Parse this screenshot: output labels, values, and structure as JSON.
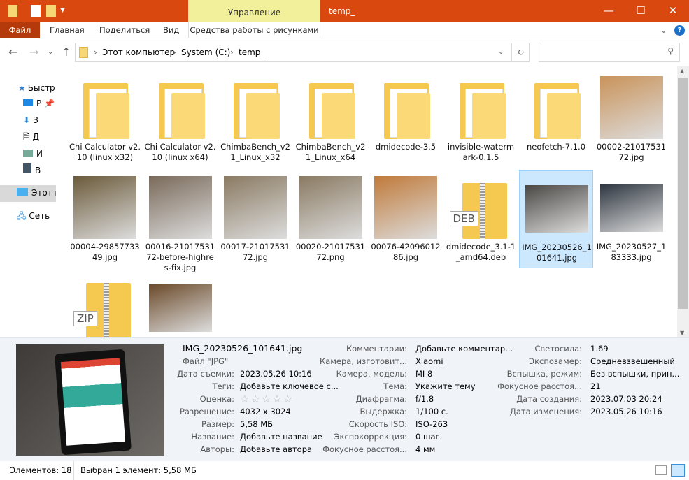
{
  "window": {
    "title": "temp_",
    "context_tab": "Управление",
    "minimize": "—",
    "maximize": "☐",
    "close": "✕"
  },
  "ribbon": {
    "tabs": [
      "Файл",
      "Главная",
      "Поделиться",
      "Вид",
      "Средства работы с рисунками"
    ],
    "expand": "⌄",
    "help": "?"
  },
  "address": {
    "crumbs": [
      "Этот компьютер",
      "System (C:)",
      "temp_"
    ],
    "search_placeholder": ""
  },
  "nav_pane": {
    "items": [
      "Быстр",
      "Р",
      "З",
      "Д",
      "И",
      "В",
      "Этот к",
      "Сеть"
    ]
  },
  "files": [
    {
      "name": "Chi Calculator v2.10 (linux x32)",
      "type": "folder"
    },
    {
      "name": "Chi Calculator v2.10 (linux x64)",
      "type": "folder"
    },
    {
      "name": "ChimbaBench_v21_Linux_x32",
      "type": "folder"
    },
    {
      "name": "ChimbaBench_v21_Linux_x64",
      "type": "folder"
    },
    {
      "name": "dmidecode-3.5",
      "type": "folder"
    },
    {
      "name": "invisible-watermark-0.1.5",
      "type": "folder"
    },
    {
      "name": "neofetch-7.1.0",
      "type": "folder"
    },
    {
      "name": "00002-2101753172.jpg",
      "type": "image",
      "color": "#c9935a"
    },
    {
      "name": "00004-2985773349.jpg",
      "type": "image",
      "color": "#6b5a3a"
    },
    {
      "name": "00016-2101753172-before-highres-fix.jpg",
      "type": "image",
      "color": "#7a6a5a"
    },
    {
      "name": "00017-2101753172.jpg",
      "type": "image",
      "color": "#8a7a62"
    },
    {
      "name": "00020-2101753172.png",
      "type": "image",
      "color": "#8a7a62"
    },
    {
      "name": "00076-4209601286.jpg",
      "type": "image",
      "color": "#c07a3a"
    },
    {
      "name": "dmidecode_3.1-1_amd64.deb",
      "type": "archive",
      "tag": "DEB"
    },
    {
      "name": "IMG_20230526_101641.jpg",
      "type": "image",
      "color": "#4a4744",
      "selected": true
    },
    {
      "name": "IMG_20230527_183333.jpg",
      "type": "image",
      "color": "#2e3640"
    },
    {
      "name": "",
      "type": "archive",
      "tag": "ZIP"
    },
    {
      "name": "",
      "type": "image",
      "color": "#6b4a2a"
    }
  ],
  "details": {
    "filename": "IMG_20230526_101641.jpg",
    "filetype": "Файл \"JPG\"",
    "col1": [
      [
        "Дата съемки:",
        "2023.05.26 10:16"
      ],
      [
        "Теги:",
        "Добавьте ключевое с..."
      ],
      [
        "Оценка:",
        "☆☆☆☆☆"
      ],
      [
        "Разрешение:",
        "4032 x 3024"
      ],
      [
        "Размер:",
        "5,58 МБ"
      ],
      [
        "Название:",
        "Добавьте название"
      ],
      [
        "Авторы:",
        "Добавьте автора"
      ]
    ],
    "col2": [
      [
        "Комментарии:",
        "Добавьте комментар..."
      ],
      [
        "Камера, изготовит...",
        "Xiaomi"
      ],
      [
        "Камера, модель:",
        "MI 8"
      ],
      [
        "Тема:",
        "Укажите тему"
      ],
      [
        "Диафрагма:",
        "f/1.8"
      ],
      [
        "Выдержка:",
        "1/100 с."
      ],
      [
        "Скорость ISO:",
        "ISO-263"
      ],
      [
        "Экспокоррекция:",
        "0 шаг."
      ],
      [
        "Фокусное расстоя...",
        "4 мм"
      ]
    ],
    "col3": [
      [
        "Светосила:",
        "1.69"
      ],
      [
        "Экспозамер:",
        "Средневзвешенный"
      ],
      [
        "Вспышка, режим:",
        "Без вспышки, прин..."
      ],
      [
        "Фокусное расстоя...",
        "21"
      ],
      [
        "Дата создания:",
        "2023.07.03 20:24"
      ],
      [
        "Дата изменения:",
        "2023.05.26 10:16"
      ]
    ]
  },
  "status": {
    "count": "Элементов: 18",
    "selection": "Выбран 1 элемент: 5,58 МБ"
  }
}
